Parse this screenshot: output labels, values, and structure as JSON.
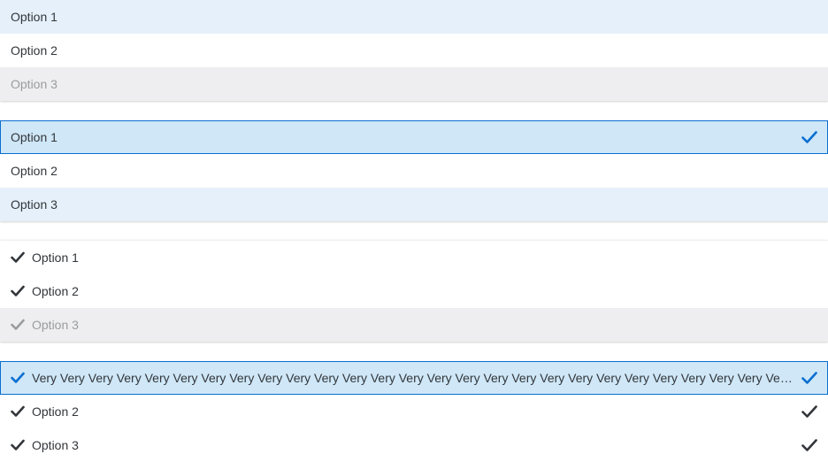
{
  "list1": {
    "items": [
      {
        "label": "Option 1"
      },
      {
        "label": "Option 2"
      },
      {
        "label": "Option 3"
      }
    ]
  },
  "list2": {
    "items": [
      {
        "label": "Option 1"
      },
      {
        "label": "Option 2"
      },
      {
        "label": "Option 3"
      }
    ]
  },
  "list3": {
    "items": [
      {
        "label": "Option 1"
      },
      {
        "label": "Option 2"
      },
      {
        "label": "Option 3"
      }
    ]
  },
  "list4": {
    "items": [
      {
        "label": "Very Very Very Very Very Very Very Very Very Very Very Very Very Very Very Very Very Very Very Very Very Very Very Very Very Very Very Very Very Very Ve..."
      },
      {
        "label": "Option 2"
      },
      {
        "label": "Option 3"
      }
    ]
  },
  "colors": {
    "accent": "#0a6ed1",
    "hover_bg": "#e5f0fa",
    "selected_bg": "#cfe7f7",
    "disabled_bg": "#eeeef0",
    "text": "#32363a",
    "disabled_text": "#9a9c9e"
  }
}
